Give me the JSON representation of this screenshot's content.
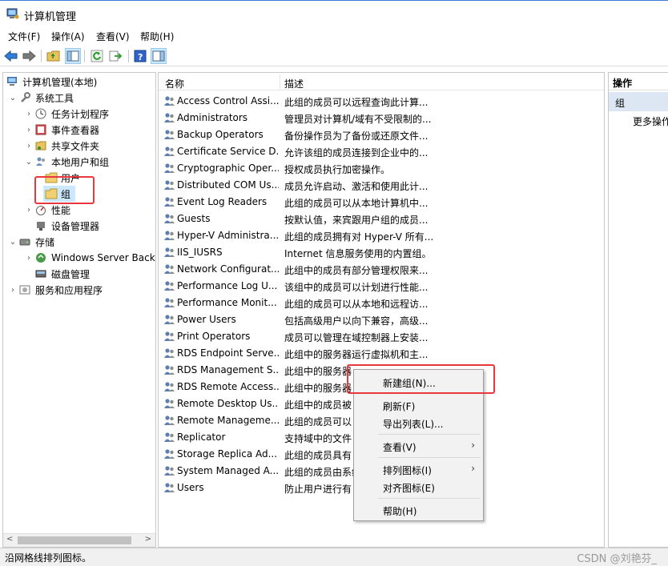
{
  "window": {
    "title": "计算机管理"
  },
  "menu": [
    "文件(F)",
    "操作(A)",
    "查看(V)",
    "帮助(H)"
  ],
  "toolbar": {
    "buttons": [
      "back-icon",
      "forward-icon",
      "up-folder-icon",
      "show-hide-tree-icon",
      "refresh-icon",
      "export-list-icon",
      "help-icon",
      "show-hide-action-pane-icon"
    ]
  },
  "tree": {
    "root": "计算机管理(本地)",
    "system_tools": "系统工具",
    "task_scheduler": "任务计划程序",
    "event_viewer": "事件查看器",
    "shared_folders": "共享文件夹",
    "local_users_groups": "本地用户和组",
    "users": "用户",
    "groups": "组",
    "performance": "性能",
    "device_manager": "设备管理器",
    "storage": "存储",
    "windows_server_backup": "Windows Server Back",
    "disk_management": "磁盘管理",
    "services_apps": "服务和应用程序"
  },
  "list": {
    "columns": [
      "名称",
      "描述"
    ],
    "rows": [
      {
        "name": "Access Control Assi...",
        "desc": "此组的成员可以远程查询此计算..."
      },
      {
        "name": "Administrators",
        "desc": "管理员对计算机/域有不受限制的..."
      },
      {
        "name": "Backup Operators",
        "desc": "备份操作员为了备份或还原文件..."
      },
      {
        "name": "Certificate Service D...",
        "desc": "允许该组的成员连接到企业中的..."
      },
      {
        "name": "Cryptographic Oper...",
        "desc": "授权成员执行加密操作。"
      },
      {
        "name": "Distributed COM Us...",
        "desc": "成员允许启动、激活和使用此计..."
      },
      {
        "name": "Event Log Readers",
        "desc": "此组的成员可以从本地计算机中..."
      },
      {
        "name": "Guests",
        "desc": "按默认值，来宾跟用户组的成员..."
      },
      {
        "name": "Hyper-V Administra...",
        "desc": "此组的成员拥有对 Hyper-V 所有..."
      },
      {
        "name": "IIS_IUSRS",
        "desc": "Internet 信息服务使用的内置组。"
      },
      {
        "name": "Network Configurat...",
        "desc": "此组中的成员有部分管理权限来..."
      },
      {
        "name": "Performance Log U...",
        "desc": "该组中的成员可以计划进行性能..."
      },
      {
        "name": "Performance Monit...",
        "desc": "此组的成员可以从本地和远程访..."
      },
      {
        "name": "Power Users",
        "desc": "包括高级用户以向下兼容，高级..."
      },
      {
        "name": "Print Operators",
        "desc": "成员可以管理在域控制器上安装..."
      },
      {
        "name": "RDS Endpoint Serve...",
        "desc": "此组中的服务器运行虚拟机和主..."
      },
      {
        "name": "RDS Management S...",
        "desc": "此组中的服务器"
      },
      {
        "name": "RDS Remote Access...",
        "desc": "此组中的服务器"
      },
      {
        "name": "Remote Desktop Us...",
        "desc": "此组中的成员被"
      },
      {
        "name": "Remote Manageme...",
        "desc": "此组的成员可以"
      },
      {
        "name": "Replicator",
        "desc": "支持域中的文件"
      },
      {
        "name": "Storage Replica Ad...",
        "desc": "此组的成员具有"
      },
      {
        "name": "System Managed A...",
        "desc": "此组的成员由系统"
      },
      {
        "name": "Users",
        "desc": "防止用户进行有"
      }
    ]
  },
  "actions": {
    "header": "操作",
    "group": "组",
    "more": "更多操作"
  },
  "context_menu": {
    "new_group": "新建组(N)...",
    "refresh": "刷新(F)",
    "export_list": "导出列表(L)...",
    "view": "查看(V)",
    "arrange_icons": "排列图标(I)",
    "line_up_icons": "对齐图标(E)",
    "help": "帮助(H)"
  },
  "status": {
    "text": "沿网格线排列图标。",
    "watermark": "CSDN @刘艳芬_"
  },
  "colors": {
    "highlight": "#e8383d",
    "selection": "#cce8ff",
    "action_group_bg": "#dde7f3"
  }
}
